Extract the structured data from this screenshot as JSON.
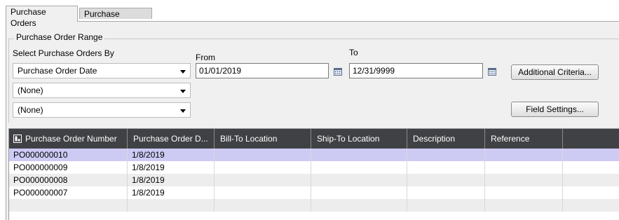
{
  "tabs": [
    {
      "label": "Purchase Orders"
    },
    {
      "label": "Purchase History"
    }
  ],
  "range": {
    "title": "Purchase Order Range",
    "select_by_label": "Select Purchase Orders By",
    "select_by_value": "Purchase Order Date",
    "from_label": "From",
    "to_label": "To",
    "from_value": "01/01/2019",
    "to_value": "12/31/9999",
    "second_combo_value": "(None)",
    "third_combo_value": "(None)"
  },
  "buttons": {
    "additional_criteria": "Additional Criteria...",
    "field_settings": "Field Settings..."
  },
  "grid": {
    "columns": [
      "Purchase Order Number",
      "Purchase Order D...",
      "Bill-To Location",
      "Ship-To Location",
      "Description",
      "Reference"
    ],
    "rows": [
      [
        "PO000000010",
        "1/8/2019",
        "",
        "",
        "",
        ""
      ],
      [
        "PO000000009",
        "1/8/2019",
        "",
        "",
        "",
        ""
      ],
      [
        "PO000000008",
        "1/8/2019",
        "",
        "",
        "",
        ""
      ],
      [
        "PO000000007",
        "1/8/2019",
        "",
        "",
        "",
        ""
      ]
    ]
  },
  "colors": {
    "header_bg": "#3f4144",
    "selected_row": "#cdcbf4",
    "alt_row": "#ededed"
  }
}
